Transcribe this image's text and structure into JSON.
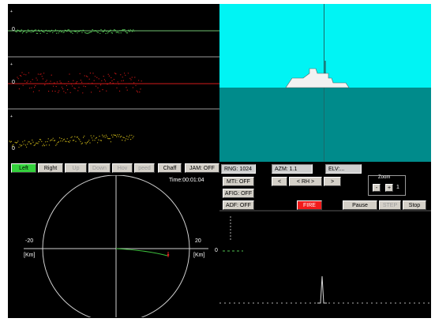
{
  "waveforms": {
    "channel_labels": [
      "0",
      "0",
      "0"
    ]
  },
  "buttons": {
    "left": "Left",
    "right": "Right",
    "up": "Up",
    "down": "Down",
    "hov": "Hov",
    "speed": "peed",
    "chaff": "Chaff",
    "jam": "JAM: OFF",
    "mti": "MTI: OFF",
    "afig": "AFIG: OFF",
    "adf": "ADF: OFF",
    "fire": "FIRE",
    "pause": "Pause",
    "step": "STEP",
    "stop": "Stop",
    "nav_left": "<",
    "nav_rh": "< RH >",
    "nav_right": ">"
  },
  "fields": {
    "ring": "RNG: 1024",
    "azm": "AZM: 1.1",
    "elv": "ELV:..."
  },
  "zoom": {
    "label": "Zoom",
    "minus": "-",
    "plus": "+",
    "value": "1"
  },
  "ppi": {
    "time": "Time:00:01:04",
    "left_range": "-20",
    "right_range": "20",
    "left_unit": "[Km]",
    "right_unit": "[Km]",
    "zero": "0"
  }
}
